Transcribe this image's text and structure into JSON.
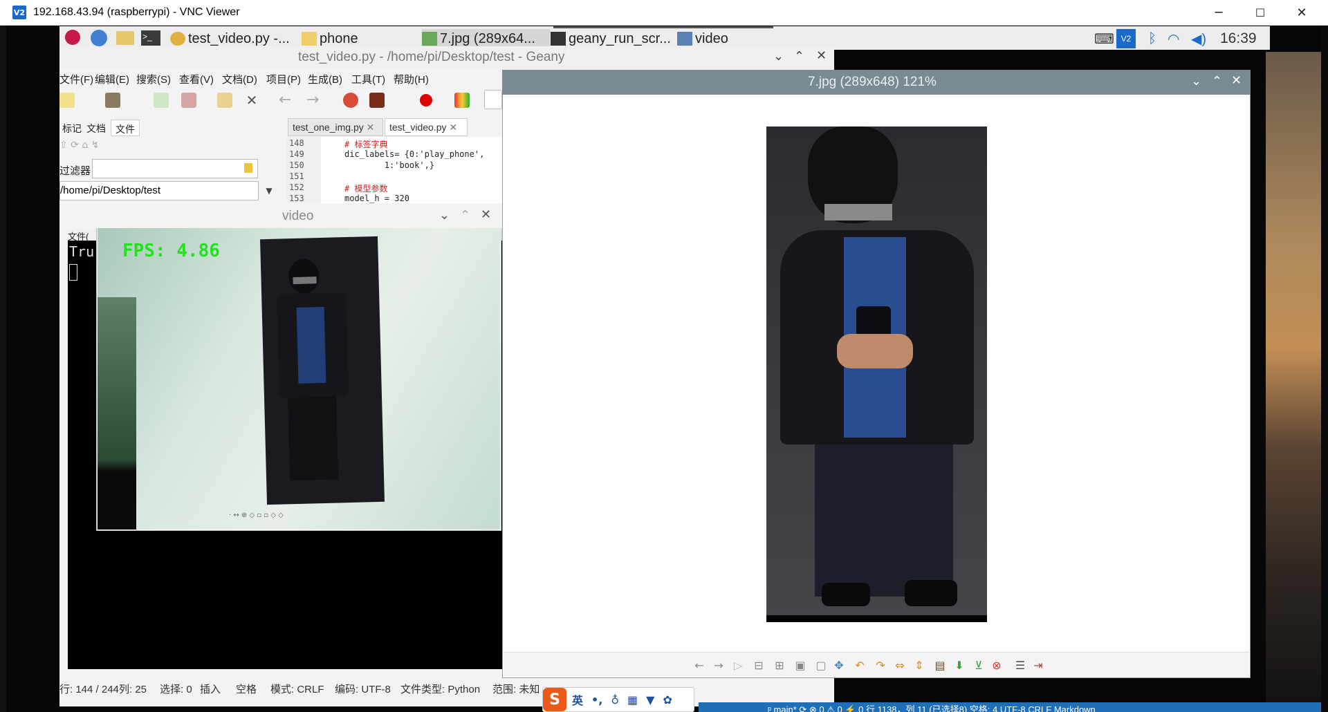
{
  "vnc": {
    "logo": "V2",
    "title": "192.168.43.94 (raspberrypi) - VNC Viewer",
    "minimize": "─",
    "maximize": "☐",
    "close": "✕"
  },
  "taskbar": {
    "items": [
      {
        "label": "test_video.py -..."
      },
      {
        "label": "phone"
      },
      {
        "label": "7.jpg (289x64..."
      },
      {
        "label": "geany_run_scr..."
      },
      {
        "label": "video"
      }
    ],
    "clock": "16:39",
    "tray_badge": "V2"
  },
  "geany": {
    "title": "test_video.py - /home/pi/Desktop/test - Geany",
    "menu": [
      "文件(F)",
      "编辑(E)",
      "搜索(S)",
      "查看(V)",
      "文档(D)",
      "项目(P)",
      "生成(B)",
      "工具(T)",
      "帮助(H)"
    ],
    "side_tabs": [
      "标记",
      "文档",
      "文件"
    ],
    "filter_label": "过滤器：",
    "path": "/home/pi/Desktop/test",
    "code_tabs": [
      "test_one_img.py",
      "test_video.py"
    ],
    "line_numbers": [
      "148",
      "149",
      "150",
      "151",
      "152",
      "153"
    ],
    "code_lines": [
      "# 标签字典",
      "dic_labels= {0:'play_phone',",
      "        1:'book',}",
      "",
      "# 模型参数",
      "model_h = 320"
    ],
    "terminal_label": "文件(",
    "terminal_text": "Tru",
    "status": {
      "line": "行: 144 / 244",
      "col": "列: 25",
      "sel": "选择: 0",
      "insert": "插入",
      "indent": "空格",
      "mode": "模式: CRLF",
      "encoding": "编码: UTF-8",
      "filetype": "文件类型: Python",
      "scope": "范围: 未知"
    }
  },
  "video_window": {
    "title": "video",
    "fps_text": "FPS: 4.86"
  },
  "image_viewer": {
    "title": "7.jpg (289x648) 121%"
  },
  "ime": {
    "lang": "英",
    "punct": "•,"
  },
  "vscode_status": {
    "text": "ᵖ main*  ⟳  ⊗ 0 ⚠ 0   ⚡ 0        行 1138，列 11 (已选择8)   空格: 4   UTF-8   CRLF   Markdown"
  },
  "colors": {
    "fps_green": "#22e21c",
    "image_title_bar": "#7a8a93",
    "vnc_accent": "#1b6ac9"
  }
}
